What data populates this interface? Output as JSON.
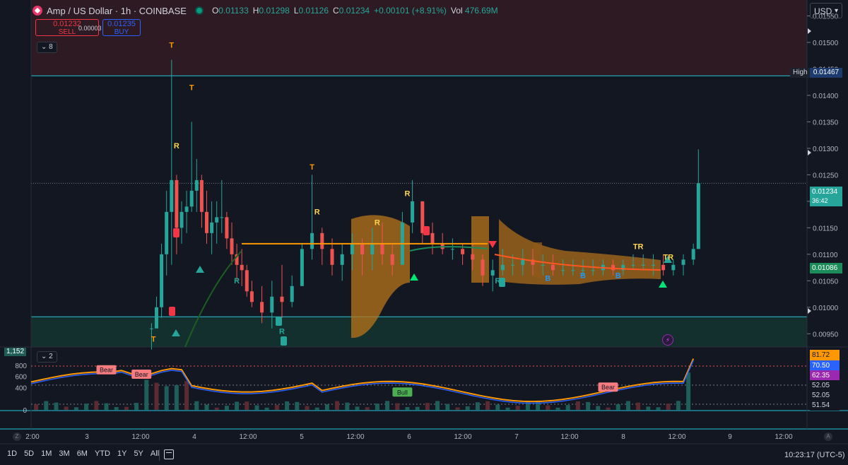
{
  "header": {
    "symbol": "Amp / US Dollar · 1h · COINBASE",
    "o_label": "O",
    "o": "0.01133",
    "h_label": "H",
    "h": "0.01298",
    "l_label": "L",
    "l": "0.01126",
    "c_label": "C",
    "c": "0.01234",
    "change": "+0.00101 (+8.91%)",
    "vol_label": "Vol",
    "vol": "476.69M"
  },
  "trade": {
    "sell_price": "0.01232",
    "sell_label": "SELL",
    "spread": "0.00003",
    "buy_price": "0.01235",
    "buy_label": "BUY"
  },
  "indicator_chip": "8",
  "sub_chip": "2",
  "currency": "USD",
  "high_label": "High",
  "high_value": "0.01467",
  "last_price": "0.01234",
  "countdown": "36:42",
  "ema_value": "0.01086",
  "flash_icon": "lightning-icon",
  "ind_badge": "1,152",
  "sub_values": [
    "81.72",
    "70.50",
    "62.35",
    "52.05",
    "52.05",
    "51.54"
  ],
  "timeframes": [
    "1D",
    "5D",
    "1M",
    "3M",
    "6M",
    "YTD",
    "1Y",
    "5Y",
    "All"
  ],
  "clock": "10:23:17 (UTC-5)",
  "zoom_z": "Z",
  "zoom_a": "A",
  "colors": {
    "up": "#26a69a",
    "down": "#ef5350",
    "ema": "#ff9800",
    "band": "#b8741a",
    "sell": "#f23645",
    "buy": "#2962ff"
  },
  "chart_data": {
    "type": "candlestick",
    "y_ticks": [
      "0.01550",
      "0.01500",
      "0.01450",
      "0.01400",
      "0.01350",
      "0.01300",
      "0.01250",
      "0.01200",
      "0.01150",
      "0.01100",
      "0.01050",
      "0.01000",
      "0.00950"
    ],
    "x_ticks": [
      "2:00",
      "3",
      "12:00",
      "4",
      "12:00",
      "5",
      "12:00",
      "6",
      "12:00",
      "7",
      "12:00",
      "8",
      "12:00",
      "9",
      "12:00"
    ],
    "sub_y_ticks": [
      "800",
      "600",
      "400",
      "0"
    ],
    "ylim": [
      0.00925,
      0.0158
    ],
    "sub_ylim": [
      0,
      1000
    ],
    "resistance_zone": [
      0.01437,
      0.0158
    ],
    "support_zone": [
      0.00925,
      0.00982
    ],
    "ema_flat": 0.0112,
    "labels": [
      {
        "text": "T",
        "t": 14,
        "y": 0.0149,
        "color": "#ff9800"
      },
      {
        "text": "T",
        "t": 16,
        "y": 0.0141,
        "color": "#ff9800"
      },
      {
        "text": "R",
        "t": 14.5,
        "y": 0.013,
        "color": "#ffd54f"
      },
      {
        "text": "T",
        "t": 28,
        "y": 0.0126,
        "color": "#ff9800"
      },
      {
        "text": "R",
        "t": 28.5,
        "y": 0.01175,
        "color": "#ffd54f"
      },
      {
        "text": "R",
        "t": 37.5,
        "y": 0.0121,
        "color": "#ffd54f"
      },
      {
        "text": "R",
        "t": 34.5,
        "y": 0.01155,
        "color": "#ffd54f"
      },
      {
        "text": "T",
        "t": 12.2,
        "y": 0.00935,
        "color": "#ff9800"
      },
      {
        "text": "R",
        "t": 20.5,
        "y": 0.01045,
        "color": "#26a69a"
      },
      {
        "text": "R",
        "t": 25.0,
        "y": 0.0095,
        "color": "#26a69a"
      },
      {
        "text": "R",
        "t": 46.5,
        "y": 0.01045,
        "color": "#26a69a"
      },
      {
        "text": "B",
        "t": 51.5,
        "y": 0.0105,
        "color": "#2196f3"
      },
      {
        "text": "B",
        "t": 55,
        "y": 0.01055,
        "color": "#2196f3"
      },
      {
        "text": "B",
        "t": 58.5,
        "y": 0.01055,
        "color": "#2196f3"
      },
      {
        "text": "TR",
        "t": 60.5,
        "y": 0.0111,
        "color": "#ffd54f"
      },
      {
        "text": "TR",
        "t": 63.5,
        "y": 0.0109,
        "color": "#ffd54f"
      }
    ],
    "sub_labels": [
      {
        "text": "Bear",
        "t": 7.5,
        "v": 700,
        "kind": "bear"
      },
      {
        "text": "Bear",
        "t": 11,
        "v": 620,
        "kind": "bear"
      },
      {
        "text": "Bull",
        "t": 37,
        "v": 300,
        "kind": "bull"
      },
      {
        "text": "Bear",
        "t": 57.5,
        "v": 390,
        "kind": "bear"
      }
    ]
  }
}
